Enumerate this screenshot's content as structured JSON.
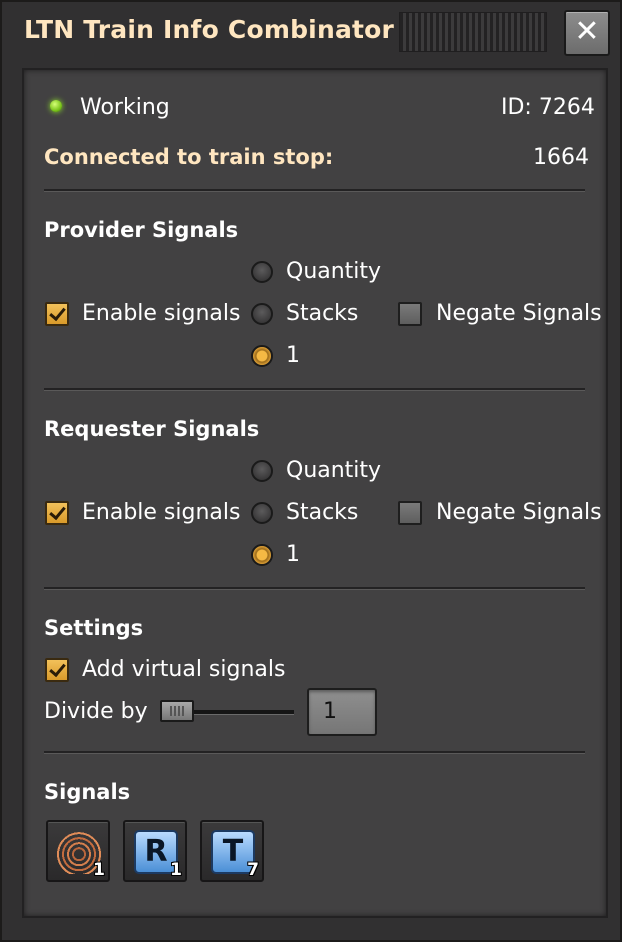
{
  "window": {
    "title": "LTN Train Info Combinator",
    "close_label": "✕"
  },
  "status": {
    "text": "Working",
    "id_text": "ID: 7264",
    "connected_label": "Connected to train stop:",
    "connected_value": "1664"
  },
  "provider": {
    "heading": "Provider Signals",
    "enable_label": "Enable signals",
    "enable_checked": true,
    "options": [
      "Quantity",
      "Stacks",
      "1"
    ],
    "selected": "1",
    "negate_label": "Negate Signals",
    "negate_checked": false
  },
  "requester": {
    "heading": "Requester Signals",
    "enable_label": "Enable signals",
    "enable_checked": true,
    "options": [
      "Quantity",
      "Stacks",
      "1"
    ],
    "selected": "1",
    "negate_label": "Negate Signals",
    "negate_checked": false
  },
  "settings": {
    "heading": "Settings",
    "virtual_label": "Add virtual signals",
    "virtual_checked": true,
    "divide_label": "Divide by",
    "divide_value": "1"
  },
  "signals": {
    "heading": "Signals",
    "items": [
      {
        "icon": "copper-cable-icon",
        "count": "1"
      },
      {
        "icon": "signal-r-icon",
        "letter": "R",
        "count": "1"
      },
      {
        "icon": "signal-t-icon",
        "letter": "T",
        "count": "7"
      }
    ]
  },
  "colors": {
    "title": "#ffe6c0",
    "checked": "#e0a238",
    "status_led": "#8ee02a",
    "panel": "#424142"
  }
}
